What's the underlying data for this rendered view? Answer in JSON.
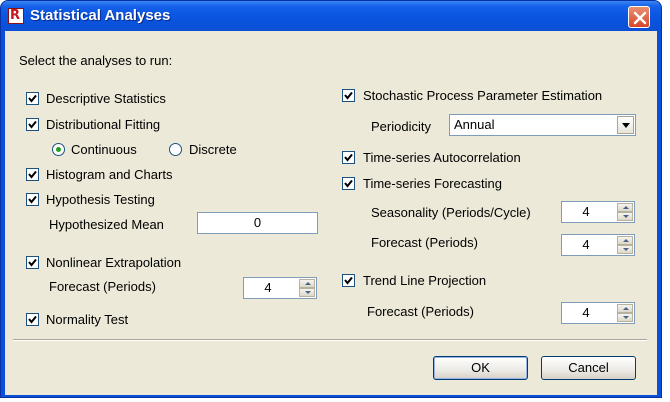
{
  "window": {
    "title": "Statistical Analyses",
    "app_icon": "risk-app-icon",
    "close_icon": "close-icon"
  },
  "instructions": "Select the analyses to run:",
  "left": {
    "descriptive": {
      "label": "Descriptive Statistics",
      "checked": true
    },
    "distributional": {
      "label": "Distributional Fitting",
      "checked": true,
      "continuous_label": "Continuous",
      "discrete_label": "Discrete",
      "selected": "Continuous"
    },
    "histogram": {
      "label": "Histogram and Charts",
      "checked": true
    },
    "hypothesis": {
      "label": "Hypothesis Testing",
      "checked": true,
      "mean_label": "Hypothesized Mean",
      "mean_value": "0"
    },
    "nonlinear": {
      "label": "Nonlinear Extrapolation",
      "checked": true,
      "forecast_label": "Forecast (Periods)",
      "forecast_value": "4"
    },
    "normality": {
      "label": "Normality Test",
      "checked": true
    }
  },
  "right": {
    "stochastic": {
      "label": "Stochastic Process  Parameter Estimation",
      "checked": true,
      "periodicity_label": "Periodicity",
      "periodicity_value": "Annual"
    },
    "autocorrelation": {
      "label": "Time-series Autocorrelation",
      "checked": true
    },
    "forecasting": {
      "label": "Time-series Forecasting",
      "checked": true,
      "seasonality_label": "Seasonality (Periods/Cycle)",
      "seasonality_value": "4",
      "forecast_label": "Forecast (Periods)",
      "forecast_value": "4"
    },
    "trend": {
      "label": "Trend Line Projection",
      "checked": true,
      "forecast_label": "Forecast (Periods)",
      "forecast_value": "4"
    }
  },
  "buttons": {
    "ok": "OK",
    "cancel": "Cancel"
  },
  "colors": {
    "titlebar": "#0a54e0",
    "dialog_bg": "#ece9d8",
    "check_mark": "#21a121",
    "close_button": "#d4472a"
  }
}
